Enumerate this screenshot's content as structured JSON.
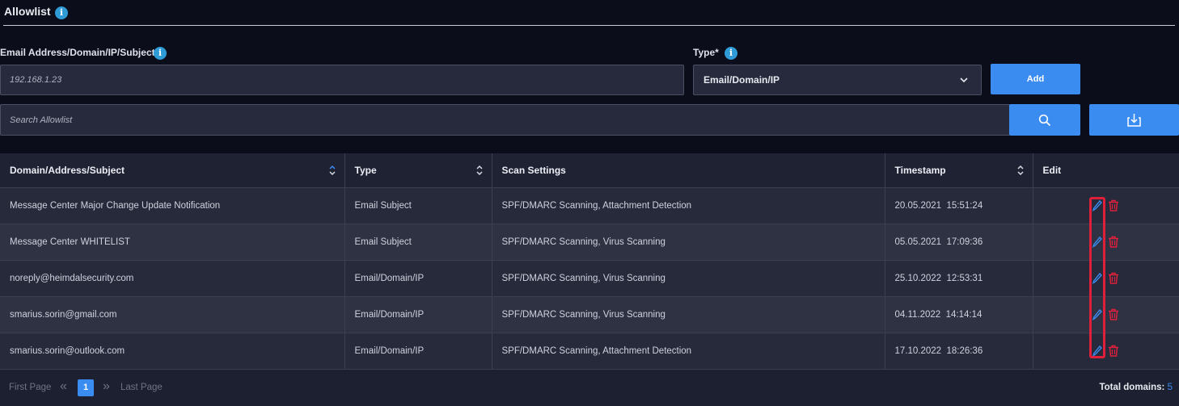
{
  "header": {
    "title": "Allowlist",
    "info_glyph": "i"
  },
  "form": {
    "address_label": "Email Address/Domain/IP/Subject",
    "address_placeholder": "192.168.1.23",
    "type_label": "Type*",
    "type_value": "Email/Domain/IP",
    "add_label": "Add",
    "search_placeholder": "Search Allowlist"
  },
  "table": {
    "columns": [
      "Domain/Address/Subject",
      "Type",
      "Scan Settings",
      "Timestamp",
      "Edit"
    ],
    "rows": [
      {
        "subject": "Message Center Major Change Update Notification",
        "type": "Email Subject",
        "scan": "SPF/DMARC Scanning, Attachment Detection",
        "date": "20.05.2021",
        "time": "15:51:24"
      },
      {
        "subject": "Message Center WHITELIST",
        "type": "Email Subject",
        "scan": "SPF/DMARC Scanning, Virus Scanning",
        "date": "05.05.2021",
        "time": "17:09:36"
      },
      {
        "subject": "noreply@heimdalsecurity.com",
        "type": "Email/Domain/IP",
        "scan": "SPF/DMARC Scanning, Virus Scanning",
        "date": "25.10.2022",
        "time": "12:53:31"
      },
      {
        "subject": "smarius.sorin@gmail.com",
        "type": "Email/Domain/IP",
        "scan": "SPF/DMARC Scanning, Virus Scanning",
        "date": "04.11.2022",
        "time": "14:14:14"
      },
      {
        "subject": "smarius.sorin@outlook.com",
        "type": "Email/Domain/IP",
        "scan": "SPF/DMARC Scanning, Attachment Detection",
        "date": "17.10.2022",
        "time": "18:26:36"
      }
    ]
  },
  "pagination": {
    "first_label": "First Page",
    "prev_glyph": "«",
    "page": "1",
    "next_glyph": "»",
    "last_label": "Last Page",
    "total_label": "Total domains:",
    "total_value": "5"
  },
  "colors": {
    "accent": "#3b8cf0",
    "danger": "#e0203a",
    "info": "#2e9ad6"
  },
  "icons": [
    "info-icon",
    "chevron-down-icon",
    "search-icon",
    "download-icon",
    "sort-icon",
    "edit-pencil-icon",
    "trash-icon"
  ]
}
